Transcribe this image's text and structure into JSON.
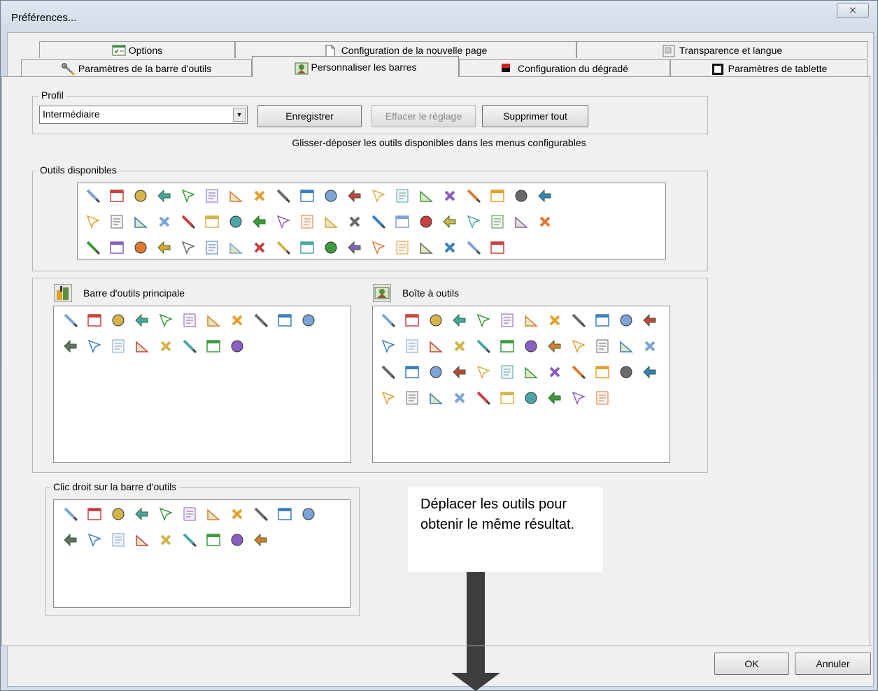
{
  "window": {
    "title": "Préférences...",
    "close_glyph": "⨯"
  },
  "tabs_row1": [
    {
      "label": "Options",
      "icon": "checklist-icon"
    },
    {
      "label": "Configuration de la nouvelle page",
      "icon": "page-icon"
    },
    {
      "label": "Transparence et langue",
      "icon": "transparency-icon"
    }
  ],
  "tabs_row2": [
    {
      "label": "Paramètres de la barre d'outils",
      "icon": "wrench-icon"
    },
    {
      "label": "Personnaliser les barres",
      "icon": "customize-toolbar-icon",
      "active": true
    },
    {
      "label": "Configuration du dégradé",
      "icon": "gradient-icon"
    },
    {
      "label": "Paramètres de tablette",
      "icon": "tablet-icon"
    }
  ],
  "profile": {
    "legend": "Profil",
    "selected": "Intermédiaire",
    "save_label": "Enregistrer",
    "reset_label": "Effacer le réglage",
    "delete_all_label": "Supprimer tout"
  },
  "hint": "Glisser-déposer les outils disponibles dans les menus configurables",
  "available_tools": {
    "legend": "Outils disponibles",
    "rows": [
      20,
      20,
      18
    ]
  },
  "main_toolbar": {
    "label": "Barre d'outils principale",
    "rows": [
      11,
      8
    ]
  },
  "toolbox": {
    "label": "Boîte à outils",
    "rows": [
      12,
      12,
      12,
      10
    ]
  },
  "right_click": {
    "legend": "Clic droit sur la barre d'outils",
    "rows": [
      11,
      9
    ]
  },
  "note": {
    "text": "Déplacer les outils pour obtenir le même résultat."
  },
  "buttons": {
    "ok_label": "OK",
    "cancel_label": "Annuler"
  },
  "palette": [
    "#7ba3d6",
    "#e2a12d",
    "#3d9a3d",
    "#c84040",
    "#6a6a6a",
    "#8b5fbf",
    "#d4b44a",
    "#3a7fc0",
    "#e07a30",
    "#4aa6a6"
  ]
}
